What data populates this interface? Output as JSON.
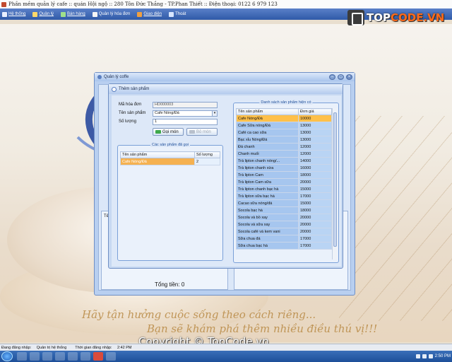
{
  "app": {
    "title": "Phần mềm quản lý cafe  :: quán Hội ngộ  :: 280 Tôn Đức Thắng - TP.Phan Thiết  :: Điện thoại: 0122 6 979 123"
  },
  "menu": [
    {
      "label": "Hệ thống",
      "icon": "system-icon"
    },
    {
      "label": "Quản lý",
      "icon": "manage-icon"
    },
    {
      "label": "Bán hàng",
      "icon": "sales-icon"
    },
    {
      "label": "Quản lý hóa đơn",
      "icon": "invoice-icon"
    },
    {
      "label": "Giao diện",
      "icon": "theme-icon"
    },
    {
      "label": "Thoát",
      "icon": "exit-icon"
    }
  ],
  "watermark": {
    "logo_prefix": "TOP",
    "logo_suffix": "CODE.VN",
    "overlay": "TopCode.vn",
    "copyright": "Copyright © TopCode.vn"
  },
  "outer_window": {
    "title": "Quản lý coffe",
    "total_label": "Tổng tiền:",
    "total_value": "0",
    "left_tab": "Tê"
  },
  "dialog": {
    "title": "Thêm sản phẩm",
    "invoice_label": "Mã hóa đơn",
    "invoice_value": "HD000003",
    "product_label": "Tên sản phẩm",
    "product_value": "Cafe Nóng/Đá",
    "qty_label": "Số lượng",
    "qty_value": "1",
    "order_button": "Gọi món",
    "remove_button": "Bỏ món",
    "ordered_group": "Các sản phẩm đã gọi",
    "ordered_headers": [
      "Tên sản phẩm",
      "Số lượng"
    ],
    "ordered_rows": [
      {
        "name": "Cafe Nóng/Đá",
        "qty": "2"
      }
    ],
    "available_group": "Danh sách sản phẩm hiện có",
    "available_headers": [
      "Tên sản phẩm",
      "Đơn giá"
    ],
    "available_rows": [
      {
        "name": "Cafe Nóng/Đá",
        "price": "10000"
      },
      {
        "name": "Cafe Sữa nóng/Đá",
        "price": "13000"
      },
      {
        "name": "Café ca cao sữa",
        "price": "13000"
      },
      {
        "name": "Bạc xỉu Nóng/Đá",
        "price": "13000"
      },
      {
        "name": "Đá chanh",
        "price": "12000"
      },
      {
        "name": "Chanh muối",
        "price": "12000"
      },
      {
        "name": "Trà lipton chanh nóng/...",
        "price": "14000"
      },
      {
        "name": "Trà lipton chanh xừa",
        "price": "16000"
      },
      {
        "name": "Trà lipton Cam",
        "price": "18000"
      },
      {
        "name": "Trà lipton Cam sữa",
        "price": "20000"
      },
      {
        "name": "Trà lipton chanh bạc hà",
        "price": "15000"
      },
      {
        "name": "Trà lipton sữa bạc hà",
        "price": "17000"
      },
      {
        "name": "Cacao sữa nóng/đá",
        "price": "15000"
      },
      {
        "name": "Socola bạc hà",
        "price": "18000"
      },
      {
        "name": "Socola và bồ xay",
        "price": "20000"
      },
      {
        "name": "Socola và sữa xay",
        "price": "20000"
      },
      {
        "name": "Socola café và kem vani",
        "price": "20000"
      },
      {
        "name": "Sữa chua đá",
        "price": "17000"
      },
      {
        "name": "Sữa chua bạc hà",
        "price": "17000"
      }
    ]
  },
  "slogan": {
    "line1": "Hãy tận hưởng cuộc sống theo cách riêng...",
    "line2": "Bạn sẽ khám phá thêm nhiều điều thú vị!!!"
  },
  "status": {
    "login_label": "Đang đăng nhập:",
    "login_value": "Quản trị hệ thống",
    "time_label": "Thời gian đăng nhập:",
    "time_value": "2:42 PM"
  },
  "taskbar": {
    "clock": "2:50 PM"
  },
  "colors": {
    "accent": "#2f5aa8",
    "selected_row": "#ffc04a",
    "list_row": "#b9d4f4"
  }
}
